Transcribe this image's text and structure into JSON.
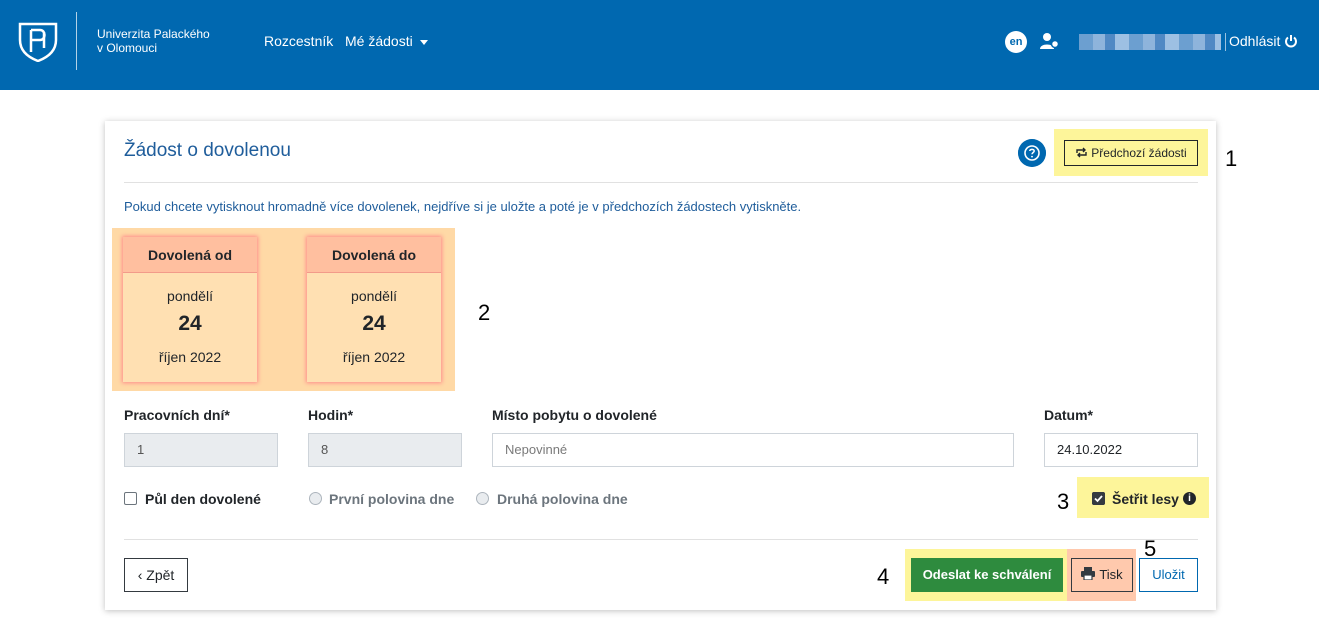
{
  "header": {
    "university_line1": "Univerzita Palackého",
    "university_line2": "v Olomouci",
    "nav_home": "Rozcestník",
    "nav_requests": "Mé žádosti",
    "lang": "en",
    "logout": "Odhlásit"
  },
  "form": {
    "title": "Žádost o dovolenou",
    "previous_button": "Předchozí žádosti",
    "info_text": "Pokud chcete vytisknout hromadně více dovolenek, nejdříve si je uložte a poté je v předchozích žádostech vytiskněte.",
    "date_from": {
      "header": "Dovolená od",
      "weekday": "pondělí",
      "day": "24",
      "month_year": "říjen 2022"
    },
    "date_to": {
      "header": "Dovolená do",
      "weekday": "pondělí",
      "day": "24",
      "month_year": "říjen 2022"
    },
    "workdays_label": "Pracovních dní*",
    "workdays_value": "1",
    "hours_label": "Hodin*",
    "hours_value": "8",
    "place_label": "Místo pobytu o dovolené",
    "place_placeholder": "Nepovinné",
    "date_label": "Datum*",
    "date_value": "24.10.2022",
    "halfday_label": "Půl den dovolené",
    "first_half_label": "První polovina dne",
    "second_half_label": "Druhá polovina dne",
    "save_forests_label": "Šetřit lesy",
    "save_forests_checked": true,
    "back_button": "Zpět",
    "send_button": "Odeslat ke schválení",
    "print_button": "Tisk",
    "save_button": "Uložit"
  },
  "annotations": {
    "n1": "1",
    "n2": "2",
    "n3": "3",
    "n4": "4",
    "n5": "5"
  },
  "colors": {
    "header_bg": "#0068b0",
    "accent": "#1f5d9b",
    "send": "#2e8b3e",
    "highlight": "#fdf59a"
  }
}
